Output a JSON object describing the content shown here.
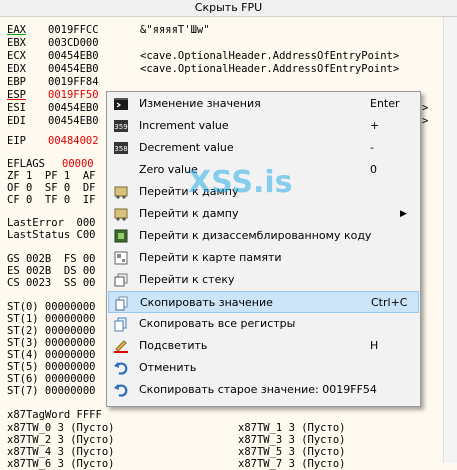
{
  "header": {
    "title": "Скрыть FPU"
  },
  "registers": [
    {
      "name": "EAX",
      "value": "0019FFCC",
      "comment": "&\"яяяяТ'Шw\"",
      "name_color": "black",
      "underline": "green"
    },
    {
      "name": "EBX",
      "value": "003CD000",
      "comment": ""
    },
    {
      "name": "ECX",
      "value": "00454EB0",
      "comment": "<cave.OptionalHeader.AddressOfEntryPoint>"
    },
    {
      "name": "EDX",
      "value": "00454EB0",
      "comment": "<cave.OptionalHeader.AddressOfEntryPoint>"
    },
    {
      "name": "EBP",
      "value": "0019FF84",
      "comment": ""
    },
    {
      "name": "ESP",
      "value": "0019FF50",
      "comment": "",
      "red": true,
      "underline": "red"
    },
    {
      "name": "ESI",
      "value": "00454EB0",
      "comment": ">"
    },
    {
      "name": "EDI",
      "value": "00454EB0",
      "comment": ">"
    },
    {
      "name": "EIP",
      "value": "00484002",
      "comment": "",
      "red": true
    }
  ],
  "eflags": {
    "label": "EFLAGS",
    "value": "00000"
  },
  "flags_rows": [
    "ZF 1  PF 1  AF",
    "OF 0  SF 0  DF",
    "CF 0  TF 0  IF"
  ],
  "last_error": "LastError  000",
  "last_status": "LastStatus C00",
  "segments": [
    "GS 002B  FS 00",
    "ES 002B  DS 00",
    "CS 0023  SS 00"
  ],
  "fpu_st": [
    "ST(0) 00000000",
    "ST(1) 00000000",
    "ST(2) 00000000",
    "ST(3) 00000000",
    "ST(4) 00000000",
    "ST(5) 00000000",
    "ST(6) 00000000",
    "ST(7) 00000000"
  ],
  "tag_word": "x87TagWord FFFF",
  "tw_left": [
    "x87TW_0 3 (Пусто)",
    "x87TW_2 3 (Пусто)",
    "x87TW_4 3 (Пусто)",
    "x87TW_6 3 (Пусто)"
  ],
  "tw_right": [
    "x87TW_1 3 (Пусто)",
    "x87TW_3 3 (Пусто)",
    "x87TW_5 3 (Пусто)",
    "x87TW_7 3 (Пусто)"
  ],
  "watermark": "XSS.is",
  "menu": {
    "items": [
      {
        "label": "Изменение значения",
        "shortcut": "Enter",
        "icon": "terminal-icon"
      },
      {
        "label": "Increment value",
        "shortcut": "+",
        "icon": "increment-icon"
      },
      {
        "label": "Decrement value",
        "shortcut": "-",
        "icon": "decrement-icon"
      },
      {
        "label": "Zero value",
        "shortcut": "0",
        "icon": "zero-icon"
      },
      {
        "label": "Перейти к дампу",
        "shortcut": "",
        "icon": "dump-icon"
      },
      {
        "label": "Перейти к дампу",
        "shortcut": "",
        "icon": "dump-icon",
        "submenu": true
      },
      {
        "label": "Перейти к дизассемблированному коду",
        "shortcut": "",
        "icon": "cpu-icon"
      },
      {
        "label": "Перейти к карте памяти",
        "shortcut": "",
        "icon": "memory-map-icon"
      },
      {
        "label": "Перейти к стеку",
        "shortcut": "",
        "icon": "stack-icon"
      },
      {
        "label": "Скопировать значение",
        "shortcut": "Ctrl+C",
        "icon": "copy-icon",
        "highlighted": true
      },
      {
        "label": "Скопировать все регистры",
        "shortcut": "",
        "icon": "copy-all-icon"
      },
      {
        "label": "Подсветить",
        "shortcut": "H",
        "icon": "highlight-pen-icon"
      },
      {
        "label": "Отменить",
        "shortcut": "",
        "icon": "undo-icon"
      },
      {
        "label": "Скопировать старое значение: 0019FF54",
        "shortcut": "",
        "icon": "undo-copy-icon"
      }
    ]
  },
  "colors": {
    "accent_red": "#e00000",
    "highlight": "#cce4f7",
    "background": "#fffaf0"
  }
}
